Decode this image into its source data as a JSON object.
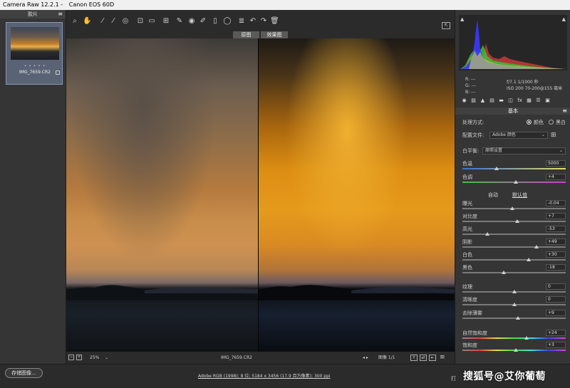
{
  "window": {
    "app": "Camera Raw 12.2.1 -",
    "camera": "Canon EOS 60D"
  },
  "filmstrip": {
    "title": "胶片",
    "filename": "IMG_7659.CR2",
    "stars": "• • • • •"
  },
  "toolbar": {
    "before_label": "原图",
    "after_label": "效果图"
  },
  "preview_status": {
    "zoom_minus": "−",
    "zoom_plus": "+",
    "zoom_level": "25%",
    "filename": "IMG_7659.CR2",
    "image_counter": "图像 1/1"
  },
  "bottom": {
    "save_label": "存储图像...",
    "workflow": "Adobe RGB (1998); 8 位; 5184 x 3456 (17.9 百万像素); 300 ppi",
    "open_label": "打",
    "watermark": "搜狐号@艾你葡萄"
  },
  "readout": {
    "r": "R:   ---",
    "g": "G:   ---",
    "b": "B:   ---",
    "aperture": "f/7.1   1/1000 秒",
    "iso": "ISO 200    70-200@155 毫米"
  },
  "basic": {
    "section_title": "基本",
    "treatment_label": "处理方式:",
    "color_option": "颜色",
    "bw_option": "黑白",
    "profile_label": "配置文件:",
    "profile_value": "Adobe 颜色",
    "wb_label": "白平衡:",
    "wb_value": "原照设置",
    "auto_label": "自动",
    "default_label": "默认值",
    "sliders": [
      {
        "name": "temperature",
        "label": "色温",
        "value": "5000",
        "pos": 0.33
      },
      {
        "name": "tint",
        "label": "色调",
        "value": "+4",
        "pos": 0.52
      },
      {
        "name": "exposure",
        "label": "曝光",
        "value": "-0.04",
        "pos": 0.48
      },
      {
        "name": "contrast",
        "label": "对比度",
        "value": "+7",
        "pos": 0.53
      },
      {
        "name": "highlights",
        "label": "高光",
        "value": "-53",
        "pos": 0.24
      },
      {
        "name": "shadows",
        "label": "阴影",
        "value": "+49",
        "pos": 0.72
      },
      {
        "name": "whites",
        "label": "白色",
        "value": "+30",
        "pos": 0.64
      },
      {
        "name": "blacks",
        "label": "黑色",
        "value": "-18",
        "pos": 0.4
      },
      {
        "name": "texture",
        "label": "纹理",
        "value": "0",
        "pos": 0.5
      },
      {
        "name": "clarity",
        "label": "清晰度",
        "value": "0",
        "pos": 0.5
      },
      {
        "name": "dehaze",
        "label": "去除薄雾",
        "value": "+9",
        "pos": 0.54
      },
      {
        "name": "vibrance",
        "label": "自然饱和度",
        "value": "+24",
        "pos": 0.62
      },
      {
        "name": "saturation",
        "label": "饱和度",
        "value": "+3",
        "pos": 0.52
      }
    ]
  }
}
